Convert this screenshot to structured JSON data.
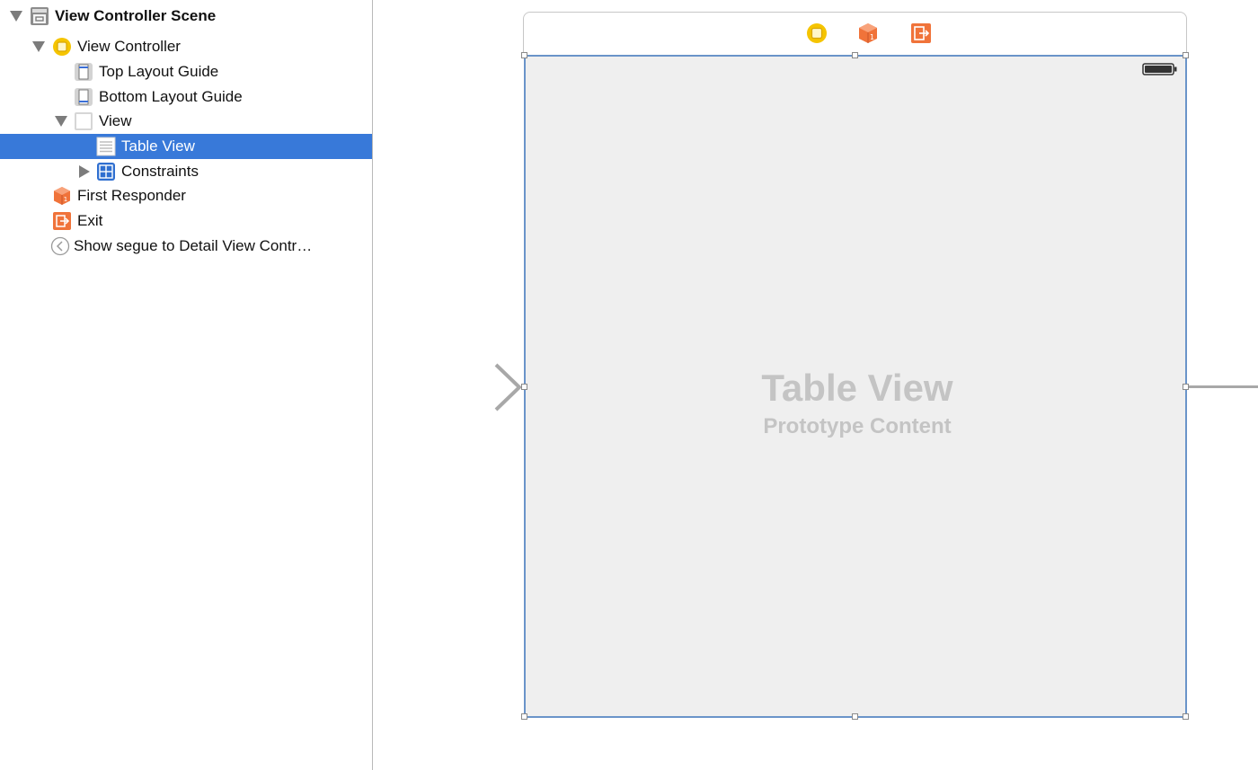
{
  "outline": {
    "items": [
      {
        "label": "View Controller Scene",
        "icon": "scene-icon",
        "disclosure": "expanded"
      },
      {
        "label": "View Controller",
        "icon": "view-controller-icon",
        "disclosure": "expanded"
      },
      {
        "label": "Top Layout Guide",
        "icon": "top-layout-guide-icon",
        "disclosure": "none"
      },
      {
        "label": "Bottom Layout Guide",
        "icon": "bottom-layout-guide-icon",
        "disclosure": "none"
      },
      {
        "label": "View",
        "icon": "view-icon",
        "disclosure": "expanded"
      },
      {
        "label": "Table View",
        "icon": "table-view-icon",
        "disclosure": "none",
        "selected": true
      },
      {
        "label": "Constraints",
        "icon": "constraints-icon",
        "disclosure": "collapsed"
      },
      {
        "label": "First Responder",
        "icon": "first-responder-icon",
        "disclosure": "none"
      },
      {
        "label": "Exit",
        "icon": "exit-icon",
        "disclosure": "none"
      },
      {
        "label": "Show segue to Detail View Contr…",
        "icon": "segue-icon",
        "disclosure": "none"
      }
    ]
  },
  "canvas": {
    "scene_bar_icons": [
      "view-controller-icon",
      "first-responder-icon",
      "exit-icon"
    ],
    "table_view_title": "Table View",
    "table_view_subtitle": "Prototype Content"
  },
  "colors": {
    "selection": "#3879d9",
    "orange": "#f0733a",
    "yellow": "#f5c400",
    "blue": "#2f6fd0"
  }
}
